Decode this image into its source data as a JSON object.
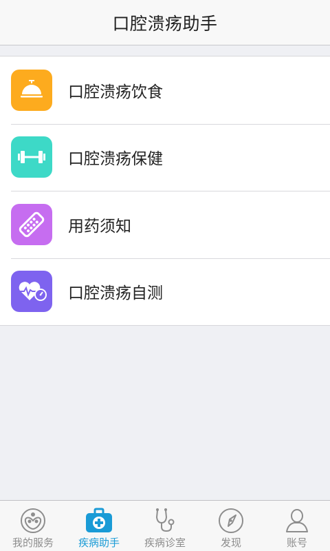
{
  "header": {
    "title": "口腔溃疡助手"
  },
  "menu": [
    {
      "label": "口腔溃疡饮食",
      "icon": "service-bell-icon",
      "color": "#fdab1e"
    },
    {
      "label": "口腔溃疡保健",
      "icon": "dumbbell-icon",
      "color": "#3dd9c7"
    },
    {
      "label": "用药须知",
      "icon": "pill-icon",
      "color": "#c66df0"
    },
    {
      "label": "口腔溃疡自测",
      "icon": "heart-rate-icon",
      "color": "#7e63ef"
    }
  ],
  "tabbar": {
    "tabs": [
      {
        "label": "我的服务",
        "icon": "services-icon",
        "active": false
      },
      {
        "label": "疾病助手",
        "icon": "medical-kit-icon",
        "active": true
      },
      {
        "label": "疾病诊室",
        "icon": "stethoscope-icon",
        "active": false
      },
      {
        "label": "发现",
        "icon": "compass-icon",
        "active": false
      },
      {
        "label": "账号",
        "icon": "user-icon",
        "active": false
      }
    ],
    "active_color": "#1a9bd6",
    "inactive_color": "#8d8d8d"
  }
}
